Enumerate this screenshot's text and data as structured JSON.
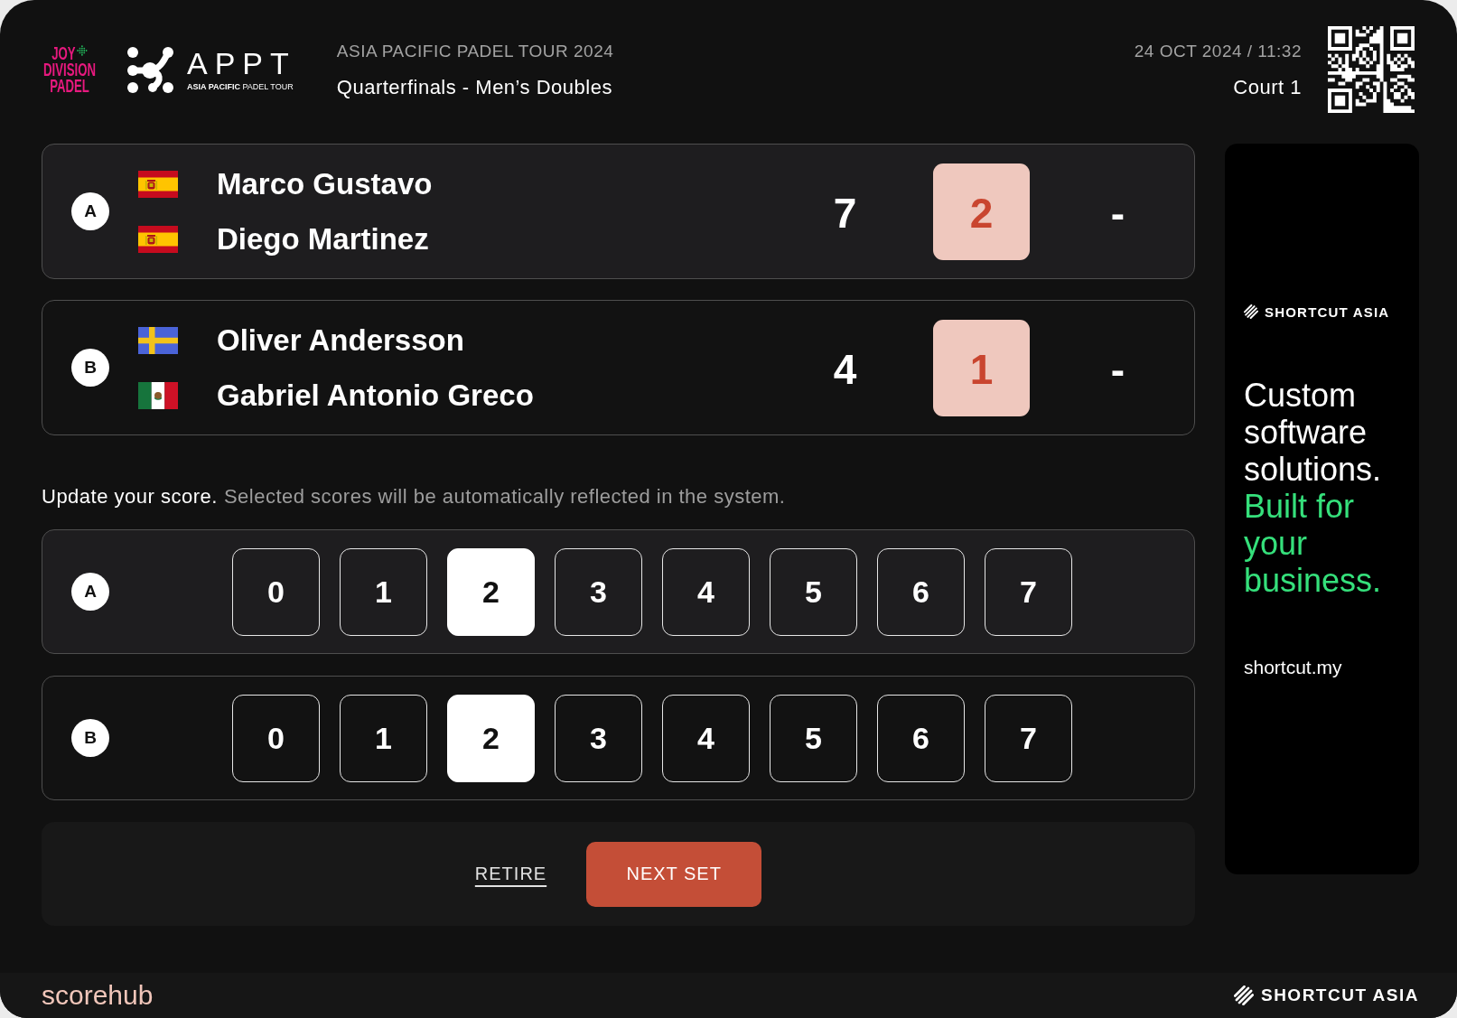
{
  "header": {
    "sponsor_logo": [
      "JOY",
      "DIVISION",
      "PADEL"
    ],
    "tour_logo": {
      "wordmark": "APPT",
      "caption": "**ASIA PACIFIC** PADEL TOUR"
    },
    "tour_name": "ASIA PACIFIC PADEL TOUR 2024",
    "round": "Quarterfinals - Men’s Doubles",
    "datetime": "24 OCT 2024 / 11:32",
    "court": "Court 1"
  },
  "teams": [
    {
      "label": "A",
      "players": [
        {
          "name": "Marco Gustavo",
          "kind": "spain"
        },
        {
          "name": "Diego Martinez",
          "kind": "spain"
        }
      ],
      "sets": [
        {
          "score": "7",
          "current": false
        },
        {
          "score": "2",
          "current": true
        },
        {
          "score": "-",
          "current": false
        }
      ]
    },
    {
      "label": "B",
      "players": [
        {
          "name": "Oliver Andersson",
          "kind": "sweden"
        },
        {
          "name": "Gabriel Antonio Greco",
          "kind": "mexico"
        }
      ],
      "sets": [
        {
          "score": "4",
          "current": false
        },
        {
          "score": "1",
          "current": true
        },
        {
          "score": "-",
          "current": false
        }
      ]
    }
  ],
  "score_update": {
    "lead": "Update your score.",
    "hint": "Selected scores will be automatically reflected in the system.",
    "rows": [
      {
        "team": "A",
        "options": [
          {
            "label": "0",
            "selected": false
          },
          {
            "label": "1",
            "selected": false
          },
          {
            "label": "2",
            "selected": true
          },
          {
            "label": "3",
            "selected": false
          },
          {
            "label": "4",
            "selected": false
          },
          {
            "label": "5",
            "selected": false
          },
          {
            "label": "6",
            "selected": false
          },
          {
            "label": "7",
            "selected": false
          }
        ]
      },
      {
        "team": "B",
        "options": [
          {
            "label": "0",
            "selected": false
          },
          {
            "label": "1",
            "selected": false
          },
          {
            "label": "2",
            "selected": true
          },
          {
            "label": "3",
            "selected": false
          },
          {
            "label": "4",
            "selected": false
          },
          {
            "label": "5",
            "selected": false
          },
          {
            "label": "6",
            "selected": false
          },
          {
            "label": "7",
            "selected": false
          }
        ]
      }
    ]
  },
  "actions": {
    "retire": "RETIRE",
    "next_set": "NEXT SET"
  },
  "ad": {
    "brand": "SHORTCUT ASIA",
    "headline": "Custom software solutions.",
    "tagline": "Built for your business.",
    "url": "shortcut.my"
  },
  "footer": {
    "app_name": "scorehub",
    "brand": "SHORTCUT ASIA"
  }
}
